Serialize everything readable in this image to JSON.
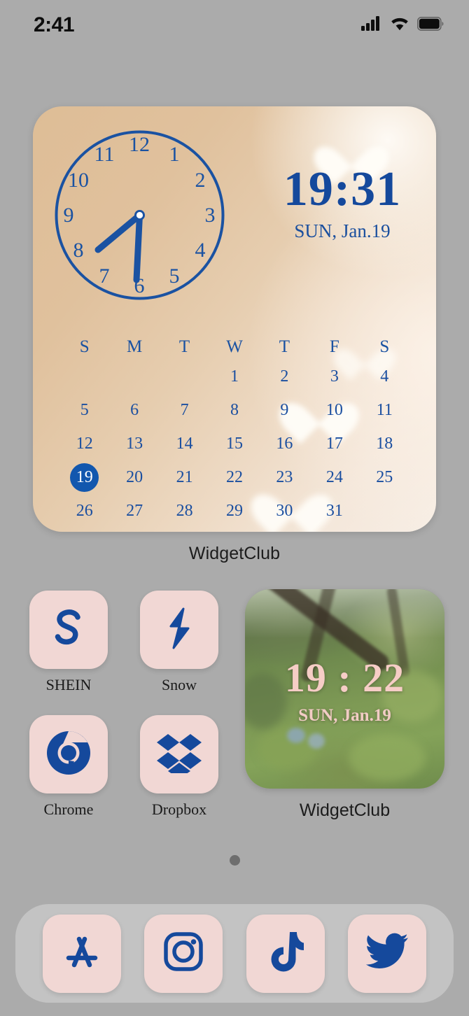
{
  "status_bar": {
    "time": "2:41",
    "cellular_icon": "cellular-signal-icon",
    "wifi_icon": "wifi-icon",
    "battery_icon": "battery-full-icon"
  },
  "colors": {
    "wallpaper_gray": "#ababab",
    "tile_pink": "#f1d7d4",
    "glyph_blue": "#15499c",
    "widget_accent_blue": "#1a52a2",
    "today_circle": "#1257ae",
    "photo_text_pink": "#f6cdc6"
  },
  "clock_widget": {
    "label": "WidgetClub",
    "analog": {
      "hour_numbers": [
        "1",
        "2",
        "3",
        "4",
        "5",
        "6",
        "7",
        "8",
        "9",
        "10",
        "11",
        "12"
      ],
      "hour_hand_target": "7",
      "minute_hand_target": "6"
    },
    "digital": {
      "time": "19:31",
      "date": "SUN, Jan.19"
    },
    "calendar": {
      "weekday_headers": [
        "S",
        "M",
        "T",
        "W",
        "T",
        "F",
        "S"
      ],
      "leading_blanks": 3,
      "days": [
        1,
        2,
        3,
        4,
        5,
        6,
        7,
        8,
        9,
        10,
        11,
        12,
        13,
        14,
        15,
        16,
        17,
        18,
        19,
        20,
        21,
        22,
        23,
        24,
        25,
        26,
        27,
        28,
        29,
        30,
        31
      ],
      "today": 19
    }
  },
  "apps": [
    {
      "name": "SHEIN",
      "icon": "shein-s-icon"
    },
    {
      "name": "Snow",
      "icon": "snow-lightning-bolt-icon"
    },
    {
      "name": "Chrome",
      "icon": "chrome-icon"
    },
    {
      "name": "Dropbox",
      "icon": "dropbox-icon"
    }
  ],
  "photo_widget": {
    "label": "WidgetClub",
    "time": "19 : 22",
    "date": "SUN, Jan.19",
    "background": "forest-photo"
  },
  "page_indicator": {
    "total_pages": 1,
    "current_page": 1
  },
  "dock": [
    {
      "name": "App Store",
      "icon": "app-store-icon"
    },
    {
      "name": "Instagram",
      "icon": "instagram-icon"
    },
    {
      "name": "TikTok",
      "icon": "tiktok-icon"
    },
    {
      "name": "Twitter",
      "icon": "twitter-bird-icon"
    }
  ]
}
